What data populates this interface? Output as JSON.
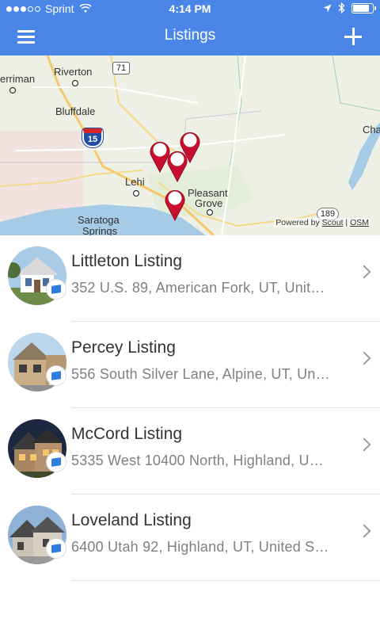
{
  "status_bar": {
    "carrier": "Sprint",
    "time": "4:14 PM",
    "signal_bars_filled": 3,
    "signal_bars_total": 5,
    "battery_level": 0.85
  },
  "nav": {
    "title": "Listings",
    "menu_icon": "hamburger-menu-icon",
    "add_icon": "plus-icon"
  },
  "map": {
    "places": {
      "riverton": "Riverton",
      "herriman": "erriman",
      "bluffdale": "Bluffdale",
      "lehi": "Lehi",
      "pleasant_grove_1": "Pleasant",
      "pleasant_grove_2": "Grove",
      "saratoga_1": "Saratoga",
      "saratoga_2": "Springs",
      "cha": "Cha"
    },
    "routes": {
      "i15": "15",
      "r71": "71",
      "r189": "189"
    },
    "attribution": {
      "prefix": "Powered by",
      "scout": "Scout",
      "separator": "|",
      "osm": "OSM"
    },
    "pin_count": 4,
    "colors": {
      "pin": "#c8102e",
      "water": "#a6cbe6",
      "land": "#eef0e6"
    }
  },
  "listings": [
    {
      "name": "Littleton Listing",
      "address": "352 U.S. 89, American Fork, UT, Unit…"
    },
    {
      "name": "Percey Listing",
      "address": "556 South Silver Lane, Alpine, UT, Un…"
    },
    {
      "name": "McCord Listing",
      "address": "5335 West 10400 North, Highland, U…"
    },
    {
      "name": "Loveland Listing",
      "address": "6400 Utah 92, Highland, UT, United S…"
    }
  ],
  "colors": {
    "accent": "#4a86e8",
    "badge": "#2f7de1"
  }
}
